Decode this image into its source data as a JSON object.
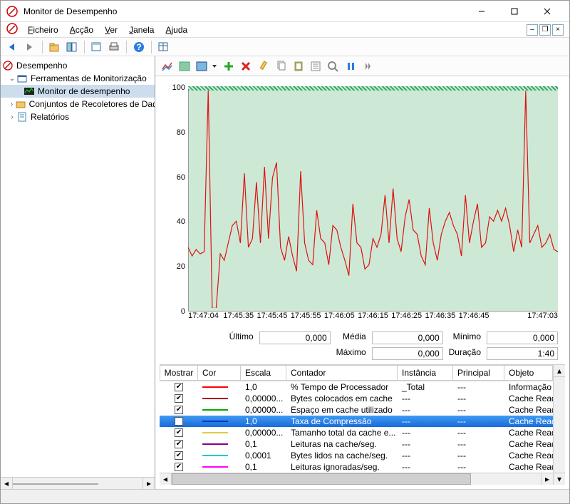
{
  "window": {
    "title": "Monitor de Desempenho"
  },
  "menu": {
    "ficheiro": "Ficheiro",
    "accao": "Acção",
    "ver": "Ver",
    "janela": "Janela",
    "ajuda": "Ajuda"
  },
  "tree": {
    "root": "Desempenho",
    "n1": "Ferramentas de Monitorização",
    "n1a": "Monitor de desempenho",
    "n2": "Conjuntos de Recoletores de Dados",
    "n3": "Relatórios"
  },
  "stats": {
    "ultimo_lab": "Último",
    "ultimo_val": "0,000",
    "media_lab": "Média",
    "media_val": "0,000",
    "minimo_lab": "Mínimo",
    "minimo_val": "0,000",
    "maximo_lab": "Máximo",
    "maximo_val": "0,000",
    "duracao_lab": "Duração",
    "duracao_val": "1:40"
  },
  "legend": {
    "headers": {
      "mostrar": "Mostrar",
      "cor": "Cor",
      "escala": "Escala",
      "contador": "Contador",
      "instancia": "Instância",
      "principal": "Principal",
      "objeto": "Objeto"
    },
    "rows": [
      {
        "color": "#ff0000",
        "escala": "1,0",
        "cont": "% Tempo de Processador",
        "inst": "_Total",
        "prin": "---",
        "obj": "Informação d"
      },
      {
        "color": "#aa0000",
        "escala": "0,00000...",
        "cont": "Bytes colocados em cache",
        "inst": "---",
        "prin": "---",
        "obj": "Cache ReadyB"
      },
      {
        "color": "#00aa00",
        "escala": "0,00000...",
        "cont": "Espaço em cache utilizado",
        "inst": "---",
        "prin": "---",
        "obj": "Cache ReadyB"
      },
      {
        "color": "#0033cc",
        "escala": "1,0",
        "cont": "Taxa de Compressão",
        "inst": "---",
        "prin": "---",
        "obj": "Cache ReadyB",
        "sel": true
      },
      {
        "color": "#ddcc44",
        "escala": "0,00000...",
        "cont": "Tamanho total da cache e...",
        "inst": "---",
        "prin": "---",
        "obj": "Cache ReadyB"
      },
      {
        "color": "#8b008b",
        "escala": "0,1",
        "cont": "Leituras na cache/seg.",
        "inst": "---",
        "prin": "---",
        "obj": "Cache ReadyB"
      },
      {
        "color": "#00cccc",
        "escala": "0,0001",
        "cont": "Bytes lidos na cache/seg.",
        "inst": "---",
        "prin": "---",
        "obj": "Cache ReadyB"
      },
      {
        "color": "#ff00ff",
        "escala": "0,1",
        "cont": "Leituras ignoradas/seg.",
        "inst": "---",
        "prin": "---",
        "obj": "Cache ReadyB"
      }
    ]
  },
  "chart_data": {
    "type": "line",
    "title": "",
    "ylabel": "",
    "ylim": [
      0,
      100
    ],
    "yticks": [
      0,
      20,
      40,
      60,
      80,
      100
    ],
    "x_ticks": [
      "17:47:04",
      "17:45:35",
      "17:45:45",
      "17:45:55",
      "17:46:05",
      "17:46:15",
      "17:46:25",
      "17:46:35",
      "17:46:45",
      "",
      "17:47:03"
    ],
    "series": [
      {
        "name": "% Tempo de Processador",
        "color": "#e01010",
        "values": [
          28,
          24,
          27,
          25,
          26,
          100,
          0,
          0,
          25,
          22,
          30,
          38,
          40,
          30,
          62,
          28,
          32,
          58,
          30,
          65,
          32,
          60,
          67,
          28,
          22,
          33,
          24,
          17,
          63,
          30,
          22,
          20,
          45,
          32,
          30,
          20,
          38,
          36,
          28,
          22,
          15,
          48,
          30,
          28,
          18,
          20,
          32,
          28,
          34,
          52,
          30,
          55,
          32,
          26,
          42,
          50,
          36,
          34,
          24,
          20,
          46,
          30,
          22,
          34,
          40,
          44,
          38,
          34,
          24,
          52,
          30,
          40,
          48,
          28,
          30,
          42,
          40,
          45,
          40,
          46,
          38,
          26,
          36,
          28,
          100,
          30,
          34,
          38,
          28,
          30,
          34,
          27,
          26
        ]
      }
    ]
  }
}
